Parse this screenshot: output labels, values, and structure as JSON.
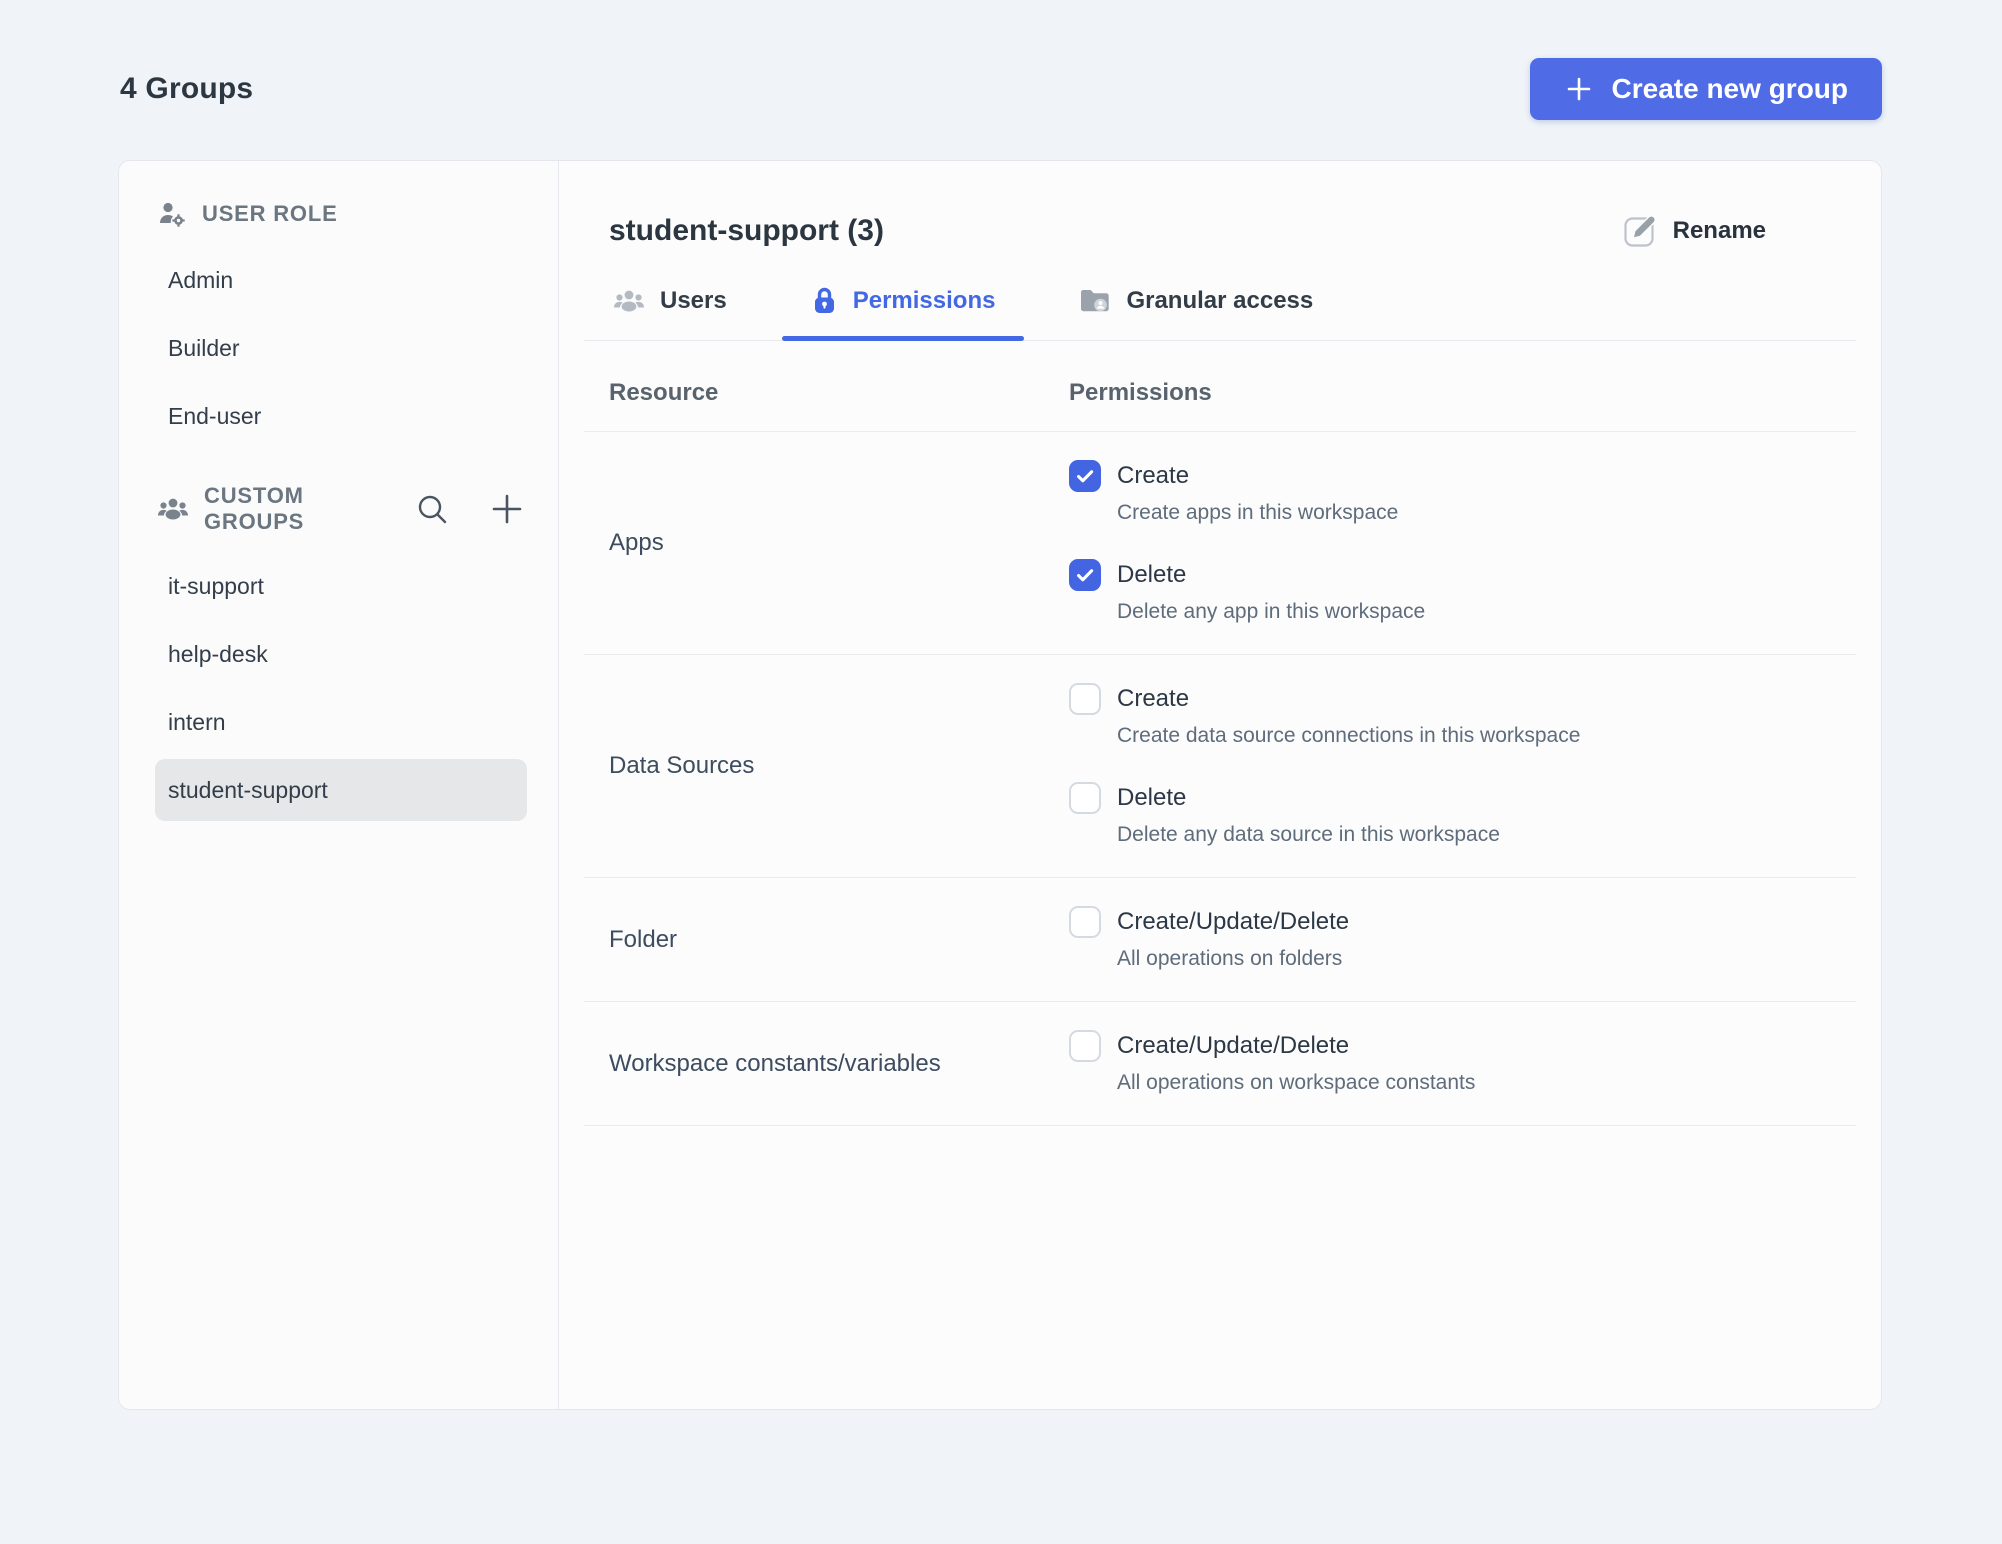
{
  "page": {
    "title": "4 Groups"
  },
  "header": {
    "create_button_label": "Create new group"
  },
  "colors": {
    "accent": "#4368e3",
    "button_blue": "#4f6be6",
    "page_background": "#f0f4f8",
    "selected_item_background": "#e5e7e9"
  },
  "sidebar": {
    "sections": [
      {
        "title": "USER ROLE",
        "icon": "user-role-icon",
        "items": [
          {
            "label": "Admin",
            "selected": false
          },
          {
            "label": "Builder",
            "selected": false
          },
          {
            "label": "End-user",
            "selected": false
          }
        ]
      },
      {
        "title": "CUSTOM GROUPS",
        "icon": "people-group-icon",
        "actions": [
          {
            "icon": "search-icon"
          },
          {
            "icon": "plus-icon"
          }
        ],
        "items": [
          {
            "label": "it-support",
            "selected": false
          },
          {
            "label": "help-desk",
            "selected": false
          },
          {
            "label": "intern",
            "selected": false
          },
          {
            "label": "student-support",
            "selected": true
          }
        ]
      }
    ]
  },
  "main": {
    "title": "student-support (3)",
    "rename_label": "Rename",
    "tabs": [
      {
        "label": "Users",
        "icon": "users-icon",
        "active": false
      },
      {
        "label": "Permissions",
        "icon": "lock-icon",
        "active": true
      },
      {
        "label": "Granular access",
        "icon": "folder-user-icon",
        "active": false
      }
    ],
    "table": {
      "columns": {
        "resource": "Resource",
        "permissions": "Permissions"
      },
      "rows": [
        {
          "resource": "Apps",
          "permissions": [
            {
              "label": "Create",
              "description": "Create apps in this workspace",
              "checked": true
            },
            {
              "label": "Delete",
              "description": "Delete any app in this workspace",
              "checked": true
            }
          ]
        },
        {
          "resource": "Data Sources",
          "permissions": [
            {
              "label": "Create",
              "description": "Create data source connections in this workspace",
              "checked": false
            },
            {
              "label": "Delete",
              "description": "Delete any data source in this workspace",
              "checked": false
            }
          ]
        },
        {
          "resource": "Folder",
          "permissions": [
            {
              "label": "Create/Update/Delete",
              "description": "All operations on folders",
              "checked": false
            }
          ]
        },
        {
          "resource": "Workspace constants/variables",
          "permissions": [
            {
              "label": "Create/Update/Delete",
              "description": "All operations on workspace constants",
              "checked": false
            }
          ]
        }
      ]
    }
  }
}
